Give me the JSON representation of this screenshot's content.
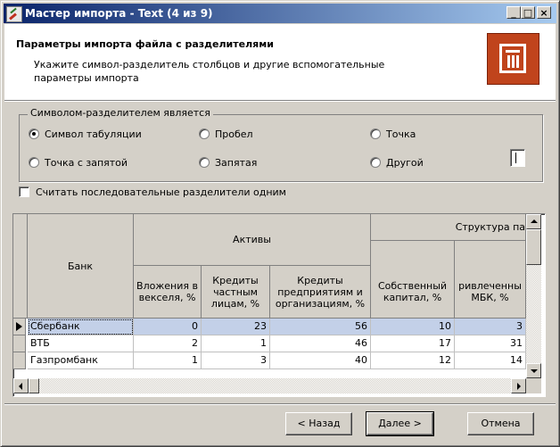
{
  "window": {
    "title": "Мастер импорта - Text (4 из 9)",
    "minimize": "_",
    "maximize": "□",
    "close": "×"
  },
  "header": {
    "title": "Параметры импорта файла с разделителями",
    "description": "Укажите символ-разделитель столбцов и другие вспомогательные параметры импорта"
  },
  "delimiter": {
    "group_title": "Символом-разделителем является",
    "options": [
      {
        "label": "Символ табуляции",
        "selected": true
      },
      {
        "label": "Пробел",
        "selected": false
      },
      {
        "label": "Точка",
        "selected": false
      },
      {
        "label": "Точка с запятой",
        "selected": false
      },
      {
        "label": "Запятая",
        "selected": false
      },
      {
        "label": "Другой",
        "selected": false
      }
    ],
    "other_value": ""
  },
  "consecutive": {
    "label": "Считать последовательные разделители одним",
    "checked": false
  },
  "grid": {
    "headers": {
      "bank": "Банк",
      "assets": "Активы",
      "structure": "Структура па",
      "col1": "Вложения в векселя, %",
      "col2": "Кредиты частным лицам, %",
      "col3": "Кредиты предприятиям и организациям, %",
      "col4": "Собственный капитал, %",
      "col5": "ривлеченны МБК, %"
    },
    "rows": [
      {
        "bank": "Сбербанк",
        "v1": "0",
        "v2": "23",
        "v3": "56",
        "v4": "10",
        "v5": "3",
        "selected": true
      },
      {
        "bank": "ВТБ",
        "v1": "2",
        "v2": "1",
        "v3": "46",
        "v4": "17",
        "v5": "31",
        "selected": false
      },
      {
        "bank": "Газпромбанк",
        "v1": "1",
        "v2": "3",
        "v3": "40",
        "v4": "12",
        "v5": "14",
        "selected": false
      }
    ]
  },
  "buttons": {
    "back": "< Назад",
    "next": "Далее >",
    "cancel": "Отмена"
  }
}
